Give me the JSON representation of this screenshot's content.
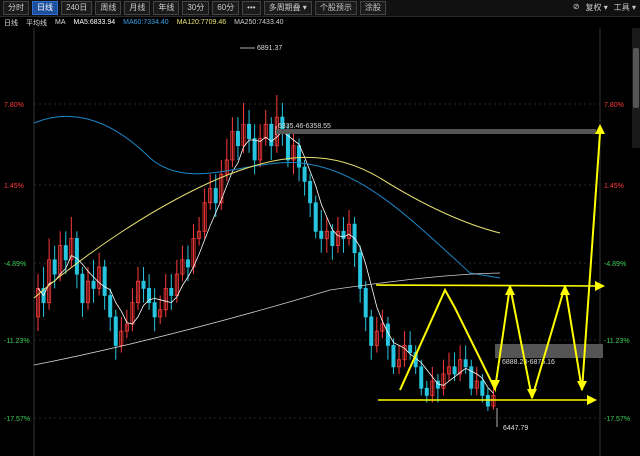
{
  "toolbar": {
    "buttons": [
      {
        "label": "分时",
        "active": false
      },
      {
        "label": "日线",
        "active": true
      },
      {
        "label": "240日",
        "active": false
      },
      {
        "label": "周线",
        "active": false
      },
      {
        "label": "月线",
        "active": false
      },
      {
        "label": "年线",
        "active": false
      },
      {
        "label": "30分",
        "active": false
      },
      {
        "label": "60分",
        "active": false
      },
      {
        "label": "•••",
        "active": false
      },
      {
        "label": "多周期叠 ▾",
        "active": false
      },
      {
        "label": "个股预示",
        "active": false
      },
      {
        "label": "涂股",
        "active": false
      }
    ],
    "right_items": [
      "⊘",
      "复权 ▾",
      "工具 ▾"
    ]
  },
  "legend": {
    "period": "日线",
    "type": "平均线",
    "ma_label": "MA",
    "ma5": "MA5:6833.94",
    "ma60": "MA60:7334.40",
    "ma120": "MA120:7709.46",
    "ma250": "MA250:7433.40"
  },
  "colors": {
    "up": "#ff3b3b",
    "down": "#27c5e0",
    "ma5": "#ffffff",
    "ma60": "#1c86c8",
    "ma120": "#e8e070",
    "ma250": "#cfcfcf",
    "annot": "#ffff00",
    "grid": "#2a2a2a"
  },
  "chart_data": {
    "type": "candlestick",
    "y_axis_left": [
      "7.80%",
      "1.45%",
      "-4.89%",
      "-11.23%",
      "-17.57%"
    ],
    "y_axis_right": [
      "7.80%",
      "1.45%",
      "-4.89%",
      "-11.23%",
      "-17.57%"
    ],
    "annotations": {
      "high": "6891.37",
      "resistance": "6335.46-6358.55",
      "support_zone": "6888.28-6875.16",
      "low": "6447.79"
    },
    "scale": {
      "price_top": 6985,
      "price_bottom": 6385
    },
    "candles": [
      [
        6580,
        6620,
        6640,
        6560
      ],
      [
        6620,
        6600,
        6650,
        6580
      ],
      [
        6600,
        6660,
        6690,
        6590
      ],
      [
        6660,
        6640,
        6680,
        6620
      ],
      [
        6640,
        6680,
        6700,
        6630
      ],
      [
        6680,
        6660,
        6700,
        6640
      ],
      [
        6660,
        6690,
        6720,
        6650
      ],
      [
        6690,
        6640,
        6700,
        6620
      ],
      [
        6640,
        6600,
        6650,
        6580
      ],
      [
        6600,
        6630,
        6650,
        6590
      ],
      [
        6630,
        6620,
        6660,
        6600
      ],
      [
        6620,
        6650,
        6670,
        6610
      ],
      [
        6650,
        6610,
        6660,
        6590
      ],
      [
        6610,
        6580,
        6620,
        6560
      ],
      [
        6580,
        6540,
        6590,
        6520
      ],
      [
        6540,
        6560,
        6580,
        6530
      ],
      [
        6560,
        6570,
        6590,
        6550
      ],
      [
        6570,
        6600,
        6620,
        6560
      ],
      [
        6600,
        6630,
        6650,
        6590
      ],
      [
        6630,
        6620,
        6650,
        6600
      ],
      [
        6620,
        6600,
        6640,
        6590
      ],
      [
        6600,
        6580,
        6620,
        6560
      ],
      [
        6580,
        6590,
        6610,
        6570
      ],
      [
        6590,
        6620,
        6640,
        6580
      ],
      [
        6620,
        6610,
        6640,
        6590
      ],
      [
        6610,
        6640,
        6660,
        6600
      ],
      [
        6640,
        6660,
        6680,
        6630
      ],
      [
        6660,
        6650,
        6680,
        6630
      ],
      [
        6650,
        6690,
        6710,
        6640
      ],
      [
        6690,
        6700,
        6720,
        6680
      ],
      [
        6700,
        6740,
        6760,
        6690
      ],
      [
        6740,
        6760,
        6780,
        6730
      ],
      [
        6760,
        6740,
        6780,
        6720
      ],
      [
        6740,
        6780,
        6800,
        6730
      ],
      [
        6780,
        6800,
        6830,
        6770
      ],
      [
        6800,
        6840,
        6860,
        6790
      ],
      [
        6840,
        6820,
        6860,
        6800
      ],
      [
        6820,
        6850,
        6880,
        6810
      ],
      [
        6850,
        6830,
        6870,
        6810
      ],
      [
        6830,
        6800,
        6850,
        6780
      ],
      [
        6800,
        6830,
        6850,
        6790
      ],
      [
        6830,
        6850,
        6870,
        6820
      ],
      [
        6850,
        6820,
        6860,
        6800
      ],
      [
        6820,
        6860,
        6891,
        6810
      ],
      [
        6860,
        6840,
        6880,
        6820
      ],
      [
        6840,
        6800,
        6850,
        6790
      ],
      [
        6800,
        6820,
        6840,
        6780
      ],
      [
        6820,
        6790,
        6830,
        6770
      ],
      [
        6790,
        6770,
        6800,
        6750
      ],
      [
        6770,
        6740,
        6780,
        6720
      ],
      [
        6740,
        6700,
        6750,
        6690
      ],
      [
        6700,
        6690,
        6730,
        6670
      ],
      [
        6690,
        6700,
        6720,
        6670
      ],
      [
        6700,
        6680,
        6710,
        6660
      ],
      [
        6680,
        6700,
        6720,
        6670
      ],
      [
        6700,
        6690,
        6720,
        6670
      ],
      [
        6690,
        6710,
        6730,
        6680
      ],
      [
        6710,
        6670,
        6720,
        6650
      ],
      [
        6670,
        6620,
        6680,
        6600
      ],
      [
        6620,
        6580,
        6630,
        6560
      ],
      [
        6580,
        6540,
        6590,
        6520
      ],
      [
        6540,
        6560,
        6580,
        6530
      ],
      [
        6560,
        6570,
        6590,
        6550
      ],
      [
        6570,
        6540,
        6580,
        6520
      ],
      [
        6540,
        6510,
        6550,
        6500
      ],
      [
        6510,
        6520,
        6540,
        6500
      ],
      [
        6520,
        6540,
        6560,
        6510
      ],
      [
        6540,
        6530,
        6560,
        6520
      ],
      [
        6530,
        6510,
        6540,
        6500
      ],
      [
        6510,
        6480,
        6520,
        6470
      ],
      [
        6480,
        6470,
        6490,
        6460
      ],
      [
        6470,
        6490,
        6510,
        6460
      ],
      [
        6490,
        6480,
        6500,
        6460
      ],
      [
        6480,
        6500,
        6520,
        6470
      ],
      [
        6500,
        6510,
        6530,
        6490
      ],
      [
        6510,
        6500,
        6530,
        6490
      ],
      [
        6500,
        6520,
        6540,
        6490
      ],
      [
        6520,
        6510,
        6540,
        6500
      ],
      [
        6510,
        6480,
        6520,
        6470
      ],
      [
        6480,
        6490,
        6510,
        6470
      ],
      [
        6490,
        6470,
        6500,
        6460
      ],
      [
        6470,
        6455,
        6480,
        6448
      ],
      [
        6455,
        6470,
        6490,
        6450
      ]
    ]
  }
}
